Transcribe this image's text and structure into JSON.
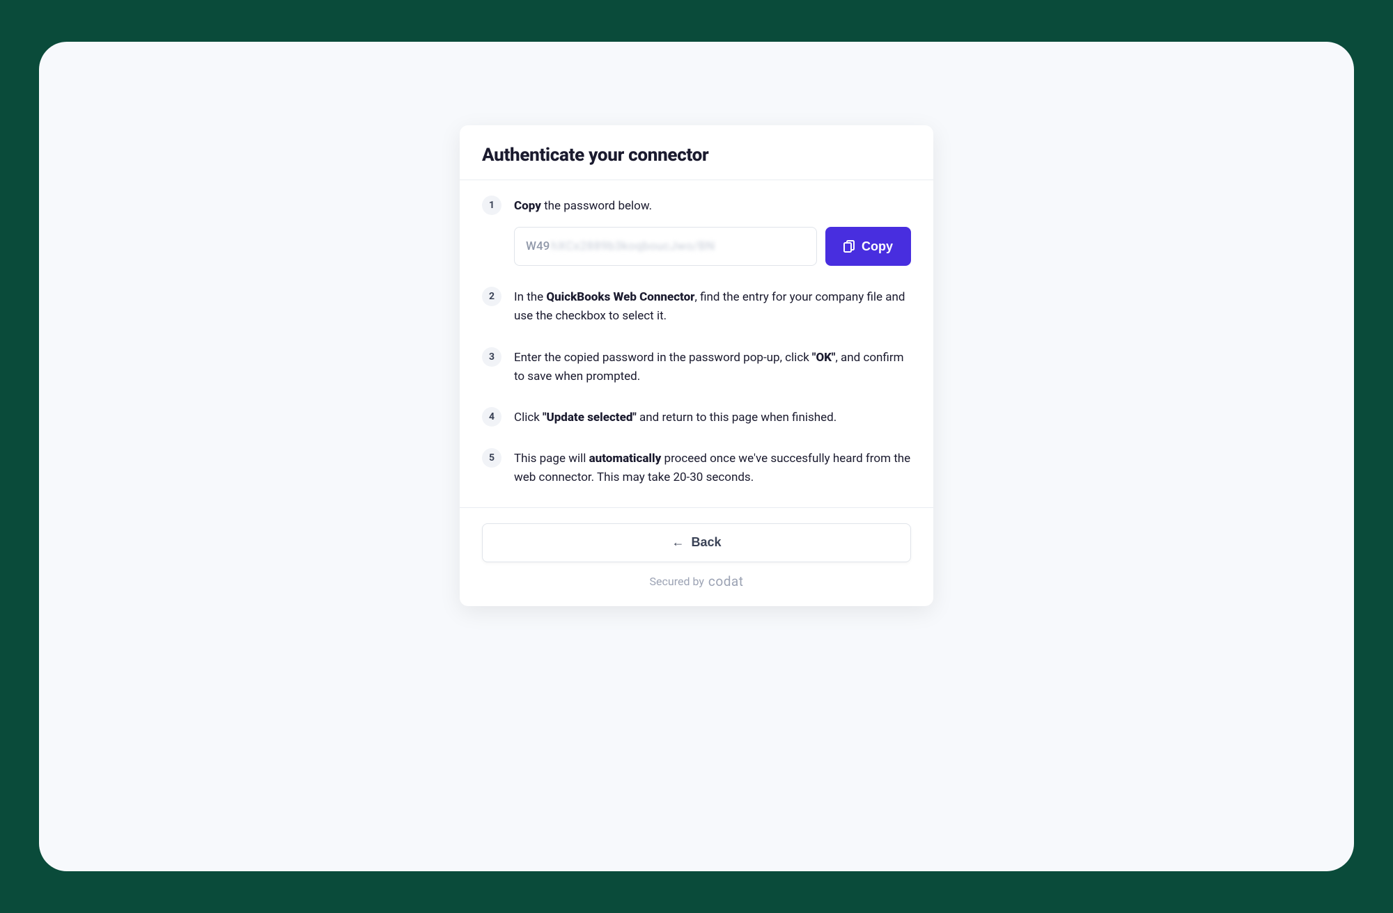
{
  "card": {
    "title": "Authenticate your connector"
  },
  "steps": [
    {
      "number": "1",
      "prefix_bold": "Copy",
      "text_after": " the password below."
    },
    {
      "number": "2",
      "text_before": "In the ",
      "bold1": "QuickBooks Web Connector",
      "text_after": ", find the entry for your company file and use the checkbox to select it."
    },
    {
      "number": "3",
      "text_before": "Enter the copied password in the password pop-up, click ",
      "bold1": "\"OK\"",
      "text_after": ", and confirm to save when prompted."
    },
    {
      "number": "4",
      "text_before": "Click ",
      "bold1": "\"Update selected\"",
      "text_after": " and return to this page when finished."
    },
    {
      "number": "5",
      "text_before": "This page will ",
      "bold1": "automatically",
      "text_after": " proceed once we've succesfully heard from the web connector. This may take 20-30 seconds."
    }
  ],
  "password": {
    "visible_prefix": "W49",
    "blurred_suffix": "hXCx2889b3koqboucJwo/BN"
  },
  "buttons": {
    "copy": "Copy",
    "back": "Back"
  },
  "footer": {
    "secured_by": "Secured by",
    "brand": "codat"
  }
}
